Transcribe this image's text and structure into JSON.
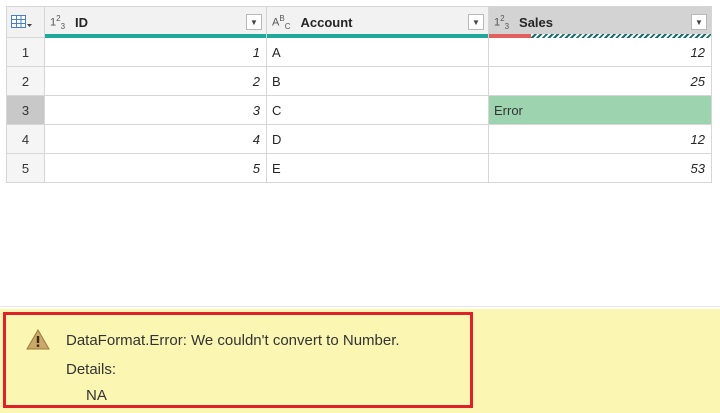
{
  "columns": [
    {
      "type_icon": {
        "base": "1",
        "sup": "2",
        "sub": "3"
      },
      "name": "ID"
    },
    {
      "type_icon": {
        "base": "A",
        "sup": "B",
        "sub": "C"
      },
      "name": "Account"
    },
    {
      "type_icon": {
        "base": "1",
        "sup": "2",
        "sub": "3"
      },
      "name": "Sales"
    }
  ],
  "rows": [
    {
      "num": "1",
      "id": "1",
      "account": "A",
      "sales": "12"
    },
    {
      "num": "2",
      "id": "2",
      "account": "B",
      "sales": "25"
    },
    {
      "num": "3",
      "id": "3",
      "account": "C",
      "sales": "Error"
    },
    {
      "num": "4",
      "id": "4",
      "account": "D",
      "sales": "12"
    },
    {
      "num": "5",
      "id": "5",
      "account": "E",
      "sales": "53"
    }
  ],
  "error_panel": {
    "message": "DataFormat.Error: We couldn't convert to Number.",
    "details_label": "Details:",
    "details_value": "NA"
  },
  "colors": {
    "quality_valid": "#1ea99a",
    "quality_error": "#e06060",
    "error_cell": "#9ed3b0",
    "error_panel_bg": "#fbf6b2",
    "error_highlight_border": "#e0202a"
  },
  "icons": {
    "table_menu": "table-icon",
    "warning": "warning-icon",
    "dropdown": "chevron-down-icon"
  }
}
